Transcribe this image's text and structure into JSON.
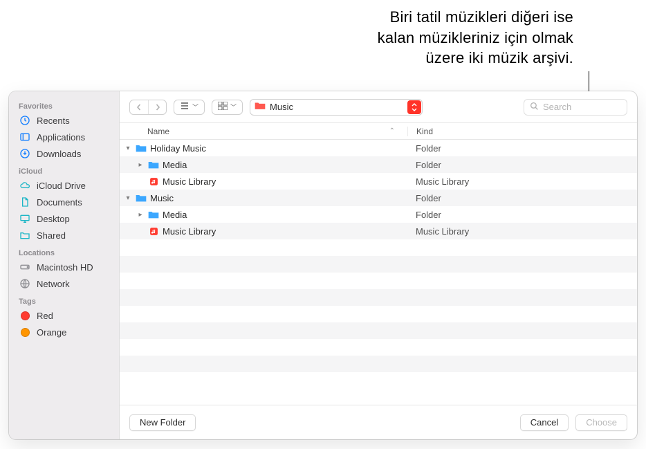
{
  "annotation": {
    "line1": "Biri tatil müzikleri diğeri ise",
    "line2": "kalan müzikleriniz için olmak",
    "line3": "üzere iki müzik arşivi."
  },
  "sidebar": {
    "sections": [
      {
        "title": "Favorites",
        "items": [
          "Recents",
          "Applications",
          "Downloads"
        ]
      },
      {
        "title": "iCloud",
        "items": [
          "iCloud Drive",
          "Documents",
          "Desktop",
          "Shared"
        ]
      },
      {
        "title": "Locations",
        "items": [
          "Macintosh HD",
          "Network"
        ]
      },
      {
        "title": "Tags",
        "items": [
          "Red",
          "Orange"
        ]
      }
    ]
  },
  "toolbar": {
    "path_label": "Music",
    "search_placeholder": "Search"
  },
  "columns": {
    "name": "Name",
    "kind": "Kind"
  },
  "rows": [
    {
      "name": "Holiday Music",
      "kind": "Folder",
      "indent": 0,
      "icon": "folder",
      "disc": "down"
    },
    {
      "name": "Media",
      "kind": "Folder",
      "indent": 1,
      "icon": "folder",
      "disc": "right"
    },
    {
      "name": "Music Library",
      "kind": "Music Library",
      "indent": 1,
      "icon": "library",
      "disc": ""
    },
    {
      "name": "Music",
      "kind": "Folder",
      "indent": 0,
      "icon": "folder",
      "disc": "down"
    },
    {
      "name": "Media",
      "kind": "Folder",
      "indent": 1,
      "icon": "folder",
      "disc": "right"
    },
    {
      "name": "Music Library",
      "kind": "Music Library",
      "indent": 1,
      "icon": "library",
      "disc": ""
    }
  ],
  "footer": {
    "new_folder": "New Folder",
    "cancel": "Cancel",
    "choose": "Choose"
  },
  "colors": {
    "accent": "#ff3329",
    "sidebar_icon": "#0f7cff",
    "gray_icon": "#8e8e93"
  }
}
